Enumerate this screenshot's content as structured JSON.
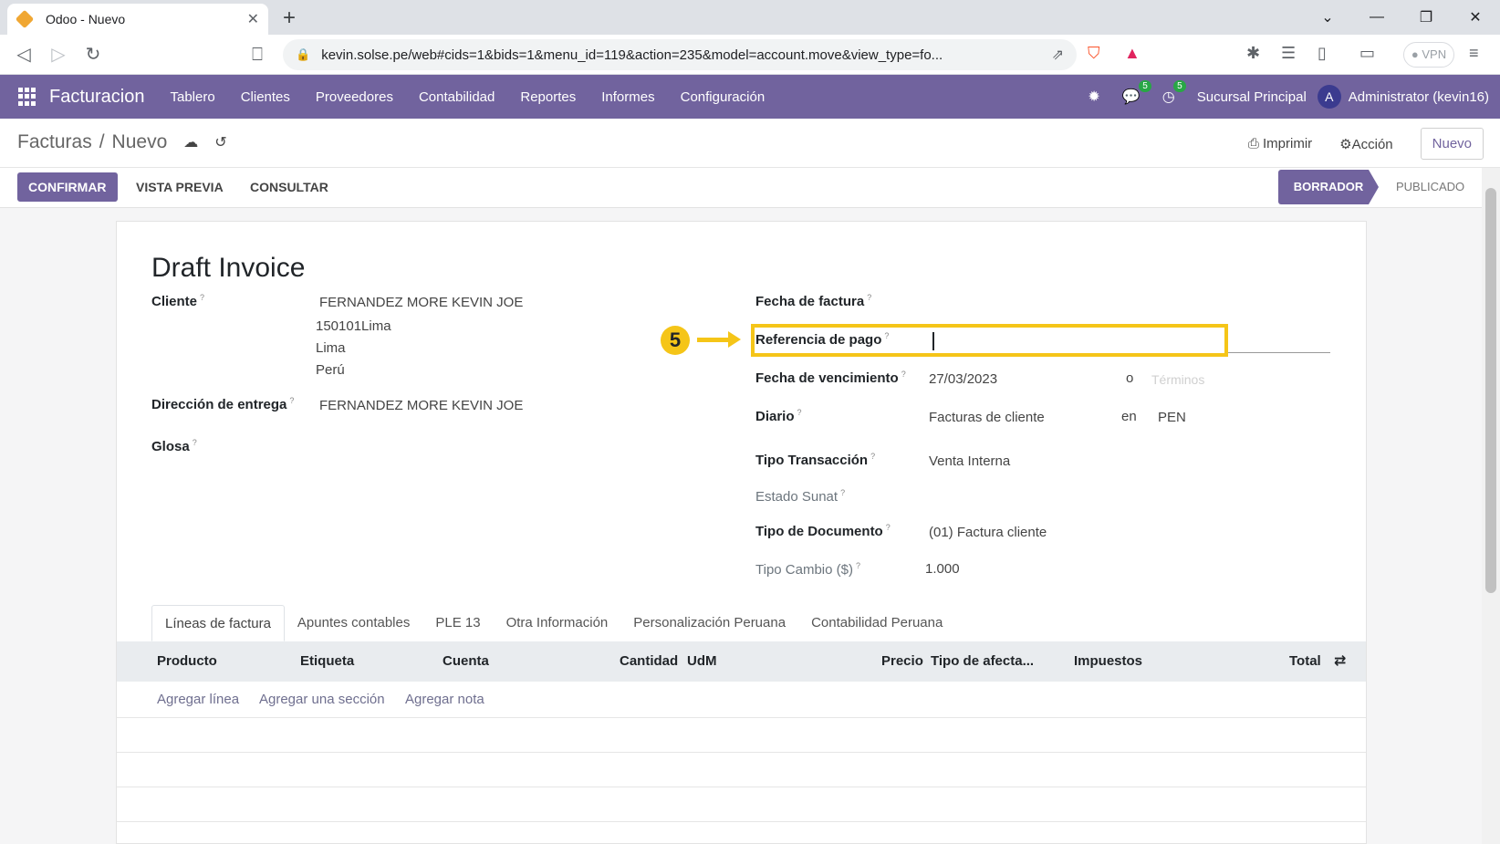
{
  "browser": {
    "tab_title": "Odoo - Nuevo",
    "url": "kevin.solse.pe/web#cids=1&bids=1&menu_id=119&action=235&model=account.move&view_type=fo...",
    "vpn_label": "VPN"
  },
  "navbar": {
    "brand": "Facturacion",
    "menu": [
      "Tablero",
      "Clientes",
      "Proveedores",
      "Contabilidad",
      "Reportes",
      "Informes",
      "Configuración"
    ],
    "messages_count": "5",
    "activities_count": "5",
    "branch": "Sucursal Principal",
    "avatar_letter": "A",
    "user": "Administrator (kevin16)",
    "color": "#71639e"
  },
  "controlpanel": {
    "breadcrumb_parent": "Facturas",
    "breadcrumb_sep": "/",
    "breadcrumb_current": "Nuevo",
    "print_label": "Imprimir",
    "action_label": "Acción",
    "new_button": "Nuevo"
  },
  "statusbar": {
    "confirm": "CONFIRMAR",
    "preview": "VISTA PREVIA",
    "consult": "CONSULTAR",
    "stage_active": "BORRADOR",
    "stage_next": "PUBLICADO"
  },
  "form": {
    "title": "Draft Invoice",
    "cliente_label": "Cliente",
    "cliente_lines": [
      "FERNANDEZ MORE KEVIN JOE",
      "150101Lima",
      "Lima",
      "Perú"
    ],
    "entrega_label": "Dirección de entrega",
    "entrega_value": "FERNANDEZ MORE KEVIN JOE",
    "glosa_label": "Glosa",
    "fecha_factura_label": "Fecha de factura",
    "referencia_label": "Referencia de pago",
    "vencimiento_label": "Fecha de vencimiento",
    "vencimiento_value": "27/03/2023",
    "o_text": "o",
    "terminos_placeholder": "Términos",
    "diario_label": "Diario",
    "diario_value": "Facturas de cliente",
    "en_text": "en",
    "currency": "PEN",
    "tipo_transaccion_label": "Tipo Transacción",
    "tipo_transaccion_value": "Venta Interna",
    "estado_sunat_label": "Estado Sunat",
    "tipo_documento_label": "Tipo de Documento",
    "tipo_documento_value": "(01) Factura cliente",
    "tipo_cambio_label": "Tipo Cambio ($)",
    "tipo_cambio_value": "1.000",
    "help_mark": "?"
  },
  "annotation": {
    "step_number": "5",
    "color": "#f5c518"
  },
  "notebook": {
    "tabs": [
      "Líneas de factura",
      "Apuntes contables",
      "PLE 13",
      "Otra Información",
      "Personalización Peruana",
      "Contabilidad Peruana"
    ],
    "columns": [
      "Producto",
      "Etiqueta",
      "Cuenta",
      "Cantidad",
      "UdM",
      "Precio",
      "Tipo de afecta...",
      "Impuestos",
      "Total"
    ],
    "add_line": "Agregar línea",
    "add_section": "Agregar una sección",
    "add_note": "Agregar nota"
  }
}
